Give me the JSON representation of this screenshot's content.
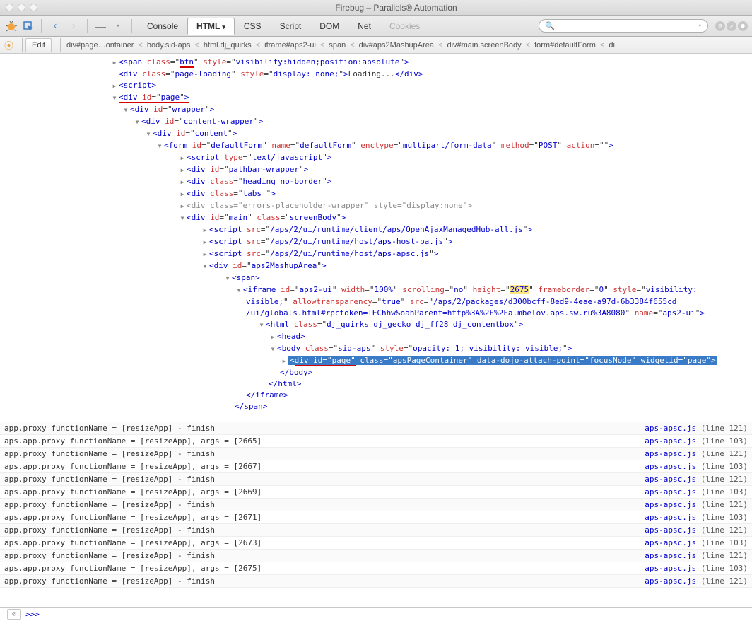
{
  "window": {
    "title": "Firebug – Parallels® Automation"
  },
  "toolbar": {
    "tabs": {
      "console": "Console",
      "html": "HTML",
      "css": "CSS",
      "script": "Script",
      "dom": "DOM",
      "net": "Net",
      "cookies": "Cookies"
    },
    "search_icon": "🔍"
  },
  "subbar": {
    "edit": "Edit",
    "crumbs": [
      "div#page…ontainer",
      "body.sid-aps",
      "html.dj_quirks",
      "iframe#aps2-ui",
      "span",
      "div#aps2MashupArea",
      "div#main.screenBody",
      "form#defaultForm",
      "di"
    ]
  },
  "tree": {
    "n1": {
      "tag": "span",
      "attrs": "class=\"btn\" style=\"visibility:hidden;position:absolute\""
    },
    "n2": {
      "tag": "div",
      "attrs": "class=\"page-loading\" style=\"display: none;\"",
      "text": "Loading..."
    },
    "n3": {
      "tag": "script"
    },
    "n4": {
      "tag": "div",
      "attrs": "id=\"page\""
    },
    "n5": {
      "tag": "div",
      "attrs": "id=\"wrapper\""
    },
    "n6": {
      "tag": "div",
      "attrs": "id=\"content-wrapper\""
    },
    "n7": {
      "tag": "div",
      "attrs": "id=\"content\""
    },
    "n8": {
      "tag": "form",
      "attrs": "id=\"defaultForm\" name=\"defaultForm\" enctype=\"multipart/form-data\" method=\"POST\" action=\"\""
    },
    "n9": {
      "tag": "script",
      "attrs": "type=\"text/javascript\""
    },
    "n10": {
      "tag": "div",
      "attrs": "id=\"pathbar-wrapper\""
    },
    "n11": {
      "tag": "div",
      "attrs": "class=\"heading no-border\""
    },
    "n12": {
      "tag": "div",
      "attrs": "class=\"tabs \""
    },
    "n13": {
      "tag": "div",
      "attrs": "class=\"errors-placeholder-wrapper\" style=\"display:none\""
    },
    "n14": {
      "tag": "div",
      "attrs": "id=\"main\" class=\"screenBody\""
    },
    "n15": {
      "tag": "script",
      "attrs": "src=\"/aps/2/ui/runtime/client/aps/OpenAjaxManagedHub-all.js\""
    },
    "n16": {
      "tag": "script",
      "attrs": "src=\"/aps/2/ui/runtime/host/aps-host-pa.js\""
    },
    "n17": {
      "tag": "script",
      "attrs": "src=\"/aps/2/ui/runtime/host/aps-apsc.js\""
    },
    "n18": {
      "tag": "div",
      "attrs": "id=\"aps2MashupArea\""
    },
    "n19": {
      "tag": "span"
    },
    "n20_pre": "<iframe id=\"aps2-ui\" width=\"100%\" scrolling=\"no\" height=\"",
    "n20_h": "2675",
    "n20_post1": "\" frameborder=\"0\" style=\"visibility:",
    "n20_line2": "visible;\" allowtransparency=\"true\" src=\"/aps/2/packages/d300bcff-8ed9-4eae-a97d-6b3384f655cd",
    "n20_line3": "/ui/globals.html#rpctoken=IEChhw&oahParent=http%3A%2F%2Fa.mbelov.aps.sw.ru%3A8080\" name=\"aps2-ui\">",
    "n21": {
      "tag": "html",
      "attrs": "class=\"dj_quirks dj_gecko dj_ff28 dj_contentbox\""
    },
    "n22": {
      "tag": "head"
    },
    "n23": {
      "tag": "body",
      "attrs": "class=\"sid-aps\" style=\"opacity: 1; visibility: visible;\""
    },
    "n24_raw": "<div id=\"page\" class=\"apsPageContainer\" data-dojo-attach-point=\"focusNode\" widgetid=\"page\">",
    "n25": "</body>",
    "n26": "</html>",
    "n27": "</iframe>",
    "n28": "</span>"
  },
  "console": {
    "rows": [
      {
        "msg": "app.proxy  functionName = [resizeApp] - finish",
        "src": "aps-apsc.js",
        "line": "121"
      },
      {
        "msg": "aps.app.proxy  functionName = [resizeApp], args = [2665]",
        "src": "aps-apsc.js",
        "line": "103"
      },
      {
        "msg": "app.proxy  functionName = [resizeApp] - finish",
        "src": "aps-apsc.js",
        "line": "121"
      },
      {
        "msg": "aps.app.proxy  functionName = [resizeApp], args = [2667]",
        "src": "aps-apsc.js",
        "line": "103"
      },
      {
        "msg": "app.proxy  functionName = [resizeApp] - finish",
        "src": "aps-apsc.js",
        "line": "121"
      },
      {
        "msg": "aps.app.proxy  functionName = [resizeApp], args = [2669]",
        "src": "aps-apsc.js",
        "line": "103"
      },
      {
        "msg": "app.proxy  functionName = [resizeApp] - finish",
        "src": "aps-apsc.js",
        "line": "121"
      },
      {
        "msg": "aps.app.proxy  functionName = [resizeApp], args = [2671]",
        "src": "aps-apsc.js",
        "line": "103"
      },
      {
        "msg": "app.proxy  functionName = [resizeApp] - finish",
        "src": "aps-apsc.js",
        "line": "121"
      },
      {
        "msg": "aps.app.proxy  functionName = [resizeApp], args = [2673]",
        "src": "aps-apsc.js",
        "line": "103"
      },
      {
        "msg": "app.proxy  functionName = [resizeApp] - finish",
        "src": "aps-apsc.js",
        "line": "121"
      },
      {
        "msg": "aps.app.proxy  functionName = [resizeApp], args = [2675]",
        "src": "aps-apsc.js",
        "line": "103"
      },
      {
        "msg": "app.proxy  functionName = [resizeApp] - finish",
        "src": "aps-apsc.js",
        "line": "121"
      }
    ],
    "prompt": ">>>"
  }
}
